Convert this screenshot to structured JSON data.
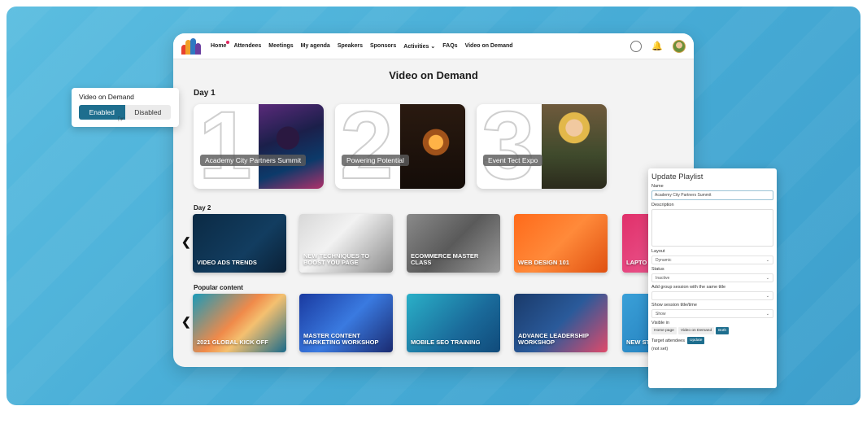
{
  "vod_toggle": {
    "title": "Video on Demand",
    "enabled_label": "Enabled",
    "disabled_label": "Disabled",
    "selected": "Enabled"
  },
  "nav": {
    "items": [
      {
        "label": "Home"
      },
      {
        "label": "Attendees"
      },
      {
        "label": "Meetings"
      },
      {
        "label": "My agenda"
      },
      {
        "label": "Speakers"
      },
      {
        "label": "Sponsors"
      },
      {
        "label": "Activities"
      },
      {
        "label": "FAQs"
      },
      {
        "label": "Video on Demand"
      }
    ]
  },
  "page": {
    "title": "Video on Demand"
  },
  "day1": {
    "label": "Day 1",
    "cards": [
      {
        "number": "1",
        "title": "Academy City Partners Summit"
      },
      {
        "number": "2",
        "title": "Powering Potential"
      },
      {
        "number": "3",
        "title": "Event Tect Expo"
      }
    ]
  },
  "day2": {
    "label": "Day 2",
    "tiles": [
      {
        "title": "VIDEO ADS TRENDS"
      },
      {
        "title": "NEW TECHNIQUES TO BOOST YOU PAGE"
      },
      {
        "title": "ECOMMERCE MASTER CLASS"
      },
      {
        "title": "WEB DESIGN 101"
      },
      {
        "title": "LAPTO"
      }
    ]
  },
  "popular": {
    "label": "Popular content",
    "tiles": [
      {
        "title": "2021 GLOBAL KICK OFF"
      },
      {
        "title": "MASTER CONTENT MARKETING WORKSHOP"
      },
      {
        "title": "MOBILE SEO TRAINING"
      },
      {
        "title": "ADVANCE LEADERSHIP WORKSHOP"
      },
      {
        "title": "NEW STRA"
      }
    ]
  },
  "playlist_panel": {
    "title": "Update Playlist",
    "name_label": "Name",
    "name_value": "Academy City Partners Summit",
    "description_label": "Description",
    "layout_label": "Layout",
    "layout_value": "Dynamic",
    "status_label": "Status",
    "status_value": "Inactive",
    "group_label": "Add group session with the same title",
    "show_label": "Show session title/time",
    "show_value": "Show",
    "visible_label": "Visible in",
    "visible_options": [
      "Home page",
      "Video on Demand",
      "Both"
    ],
    "visible_selected": "Both",
    "target_label": "Target attendees",
    "update_label": "Update",
    "not_set": "(not set)"
  },
  "colors": {
    "accent": "#1e6e8e",
    "background": "#4aafd9"
  }
}
